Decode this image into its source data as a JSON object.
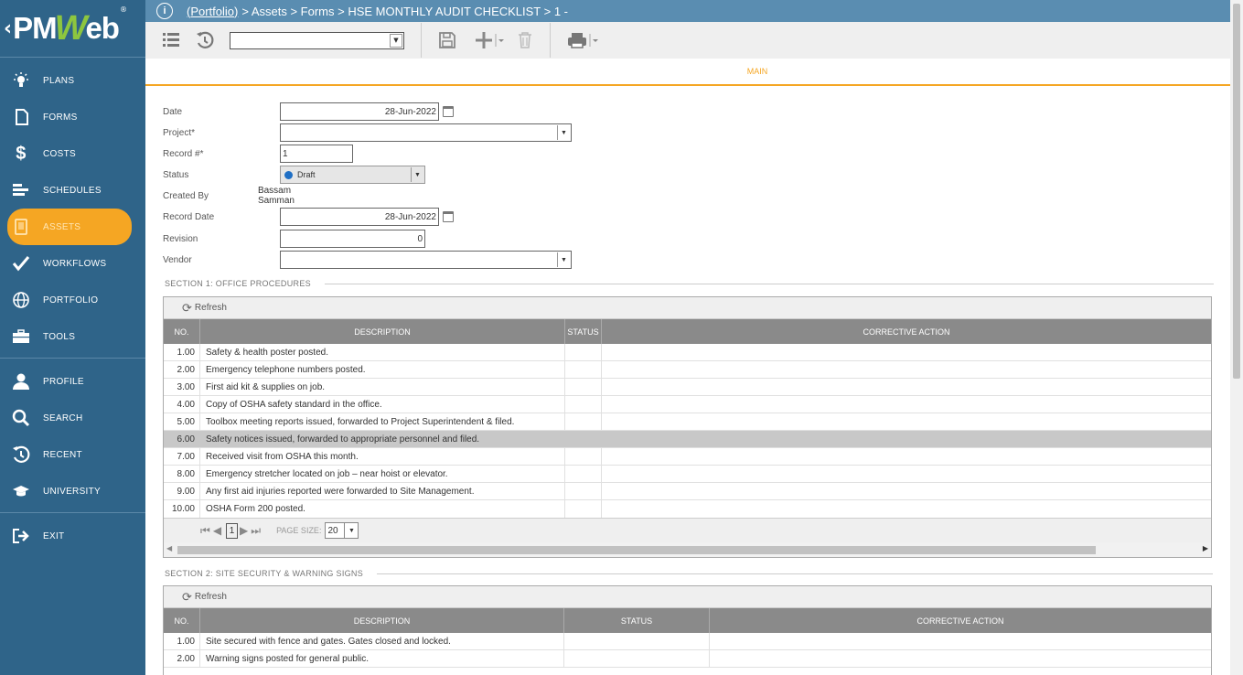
{
  "brand": {
    "logo_left": "PM",
    "logo_w": "W",
    "logo_right": "eb",
    "reg": "®"
  },
  "sidebar": {
    "items": [
      {
        "label": "PLANS",
        "icon": "lightbulb-icon"
      },
      {
        "label": "FORMS",
        "icon": "document-icon"
      },
      {
        "label": "COSTS",
        "icon": "dollar-icon"
      },
      {
        "label": "SCHEDULES",
        "icon": "gantt-icon"
      },
      {
        "label": "ASSETS",
        "icon": "tablet-icon",
        "active": true
      },
      {
        "label": "WORKFLOWS",
        "icon": "checkmark-icon"
      },
      {
        "label": "PORTFOLIO",
        "icon": "globe-icon"
      },
      {
        "label": "TOOLS",
        "icon": "toolbox-icon"
      }
    ],
    "items2": [
      {
        "label": "PROFILE",
        "icon": "user-icon"
      },
      {
        "label": "SEARCH",
        "icon": "search-icon"
      },
      {
        "label": "RECENT",
        "icon": "history-icon"
      },
      {
        "label": "UNIVERSITY",
        "icon": "graduation-cap-icon"
      }
    ],
    "exit": {
      "label": "EXIT",
      "icon": "exit-icon"
    }
  },
  "breadcrumb": {
    "portfolio": "(Portfolio)",
    "rest": "> Assets > Forms > HSE MONTHLY AUDIT CHECKLIST > 1 -"
  },
  "tabs": {
    "main": "MAIN"
  },
  "form": {
    "date_label": "Date",
    "date_value": "28-Jun-2022",
    "project_label": "Project*",
    "project_value": "",
    "record_label": "Record #*",
    "record_value": "1",
    "status_label": "Status",
    "status_value": "Draft",
    "created_by_label": "Created By",
    "created_by_value": "Bassam Samman",
    "record_date_label": "Record Date",
    "record_date_value": "28-Jun-2022",
    "revision_label": "Revision",
    "revision_value": "0",
    "vendor_label": "Vendor",
    "vendor_value": ""
  },
  "colors": {
    "sidebar": "#2f6489",
    "accent": "#f5a623",
    "topbar": "#5a8db1",
    "status_dot": "#1f6fc5"
  },
  "section1": {
    "title": "SECTION 1: OFFICE PROCEDURES",
    "refresh": "Refresh",
    "headers": {
      "no": "NO.",
      "description": "DESCRIPTION",
      "status": "STATUS",
      "corrective": "CORRECTIVE ACTION"
    },
    "rows": [
      {
        "no": "1.00",
        "desc": "Safety & health poster posted."
      },
      {
        "no": "2.00",
        "desc": "Emergency telephone numbers posted."
      },
      {
        "no": "3.00",
        "desc": "First aid kit & supplies on job."
      },
      {
        "no": "4.00",
        "desc": "Copy of OSHA safety standard in the office."
      },
      {
        "no": "5.00",
        "desc": "Toolbox meeting reports issued, forwarded to Project Superintendent & filed."
      },
      {
        "no": "6.00",
        "desc": "Safety notices issued, forwarded to appropriate personnel and filed."
      },
      {
        "no": "7.00",
        "desc": "Received visit from OSHA this month."
      },
      {
        "no": "8.00",
        "desc": "Emergency stretcher located on job – near hoist or elevator."
      },
      {
        "no": "9.00",
        "desc": "Any first aid injuries reported were forwarded to Site Management."
      },
      {
        "no": "10.00",
        "desc": "OSHA Form 200 posted."
      }
    ],
    "pager": {
      "page": "1",
      "page_size_label": "PAGE SIZE:",
      "page_size": "20"
    }
  },
  "section2": {
    "title": "SECTION 2: SITE SECURITY & WARNING SIGNS",
    "refresh": "Refresh",
    "headers": {
      "no": "NO.",
      "description": "DESCRIPTION",
      "status": "STATUS",
      "corrective": "CORRECTIVE ACTION"
    },
    "rows": [
      {
        "no": "1.00",
        "desc": "Site secured with fence and gates. Gates closed and locked."
      },
      {
        "no": "2.00",
        "desc": "Warning signs posted for general public."
      }
    ]
  }
}
